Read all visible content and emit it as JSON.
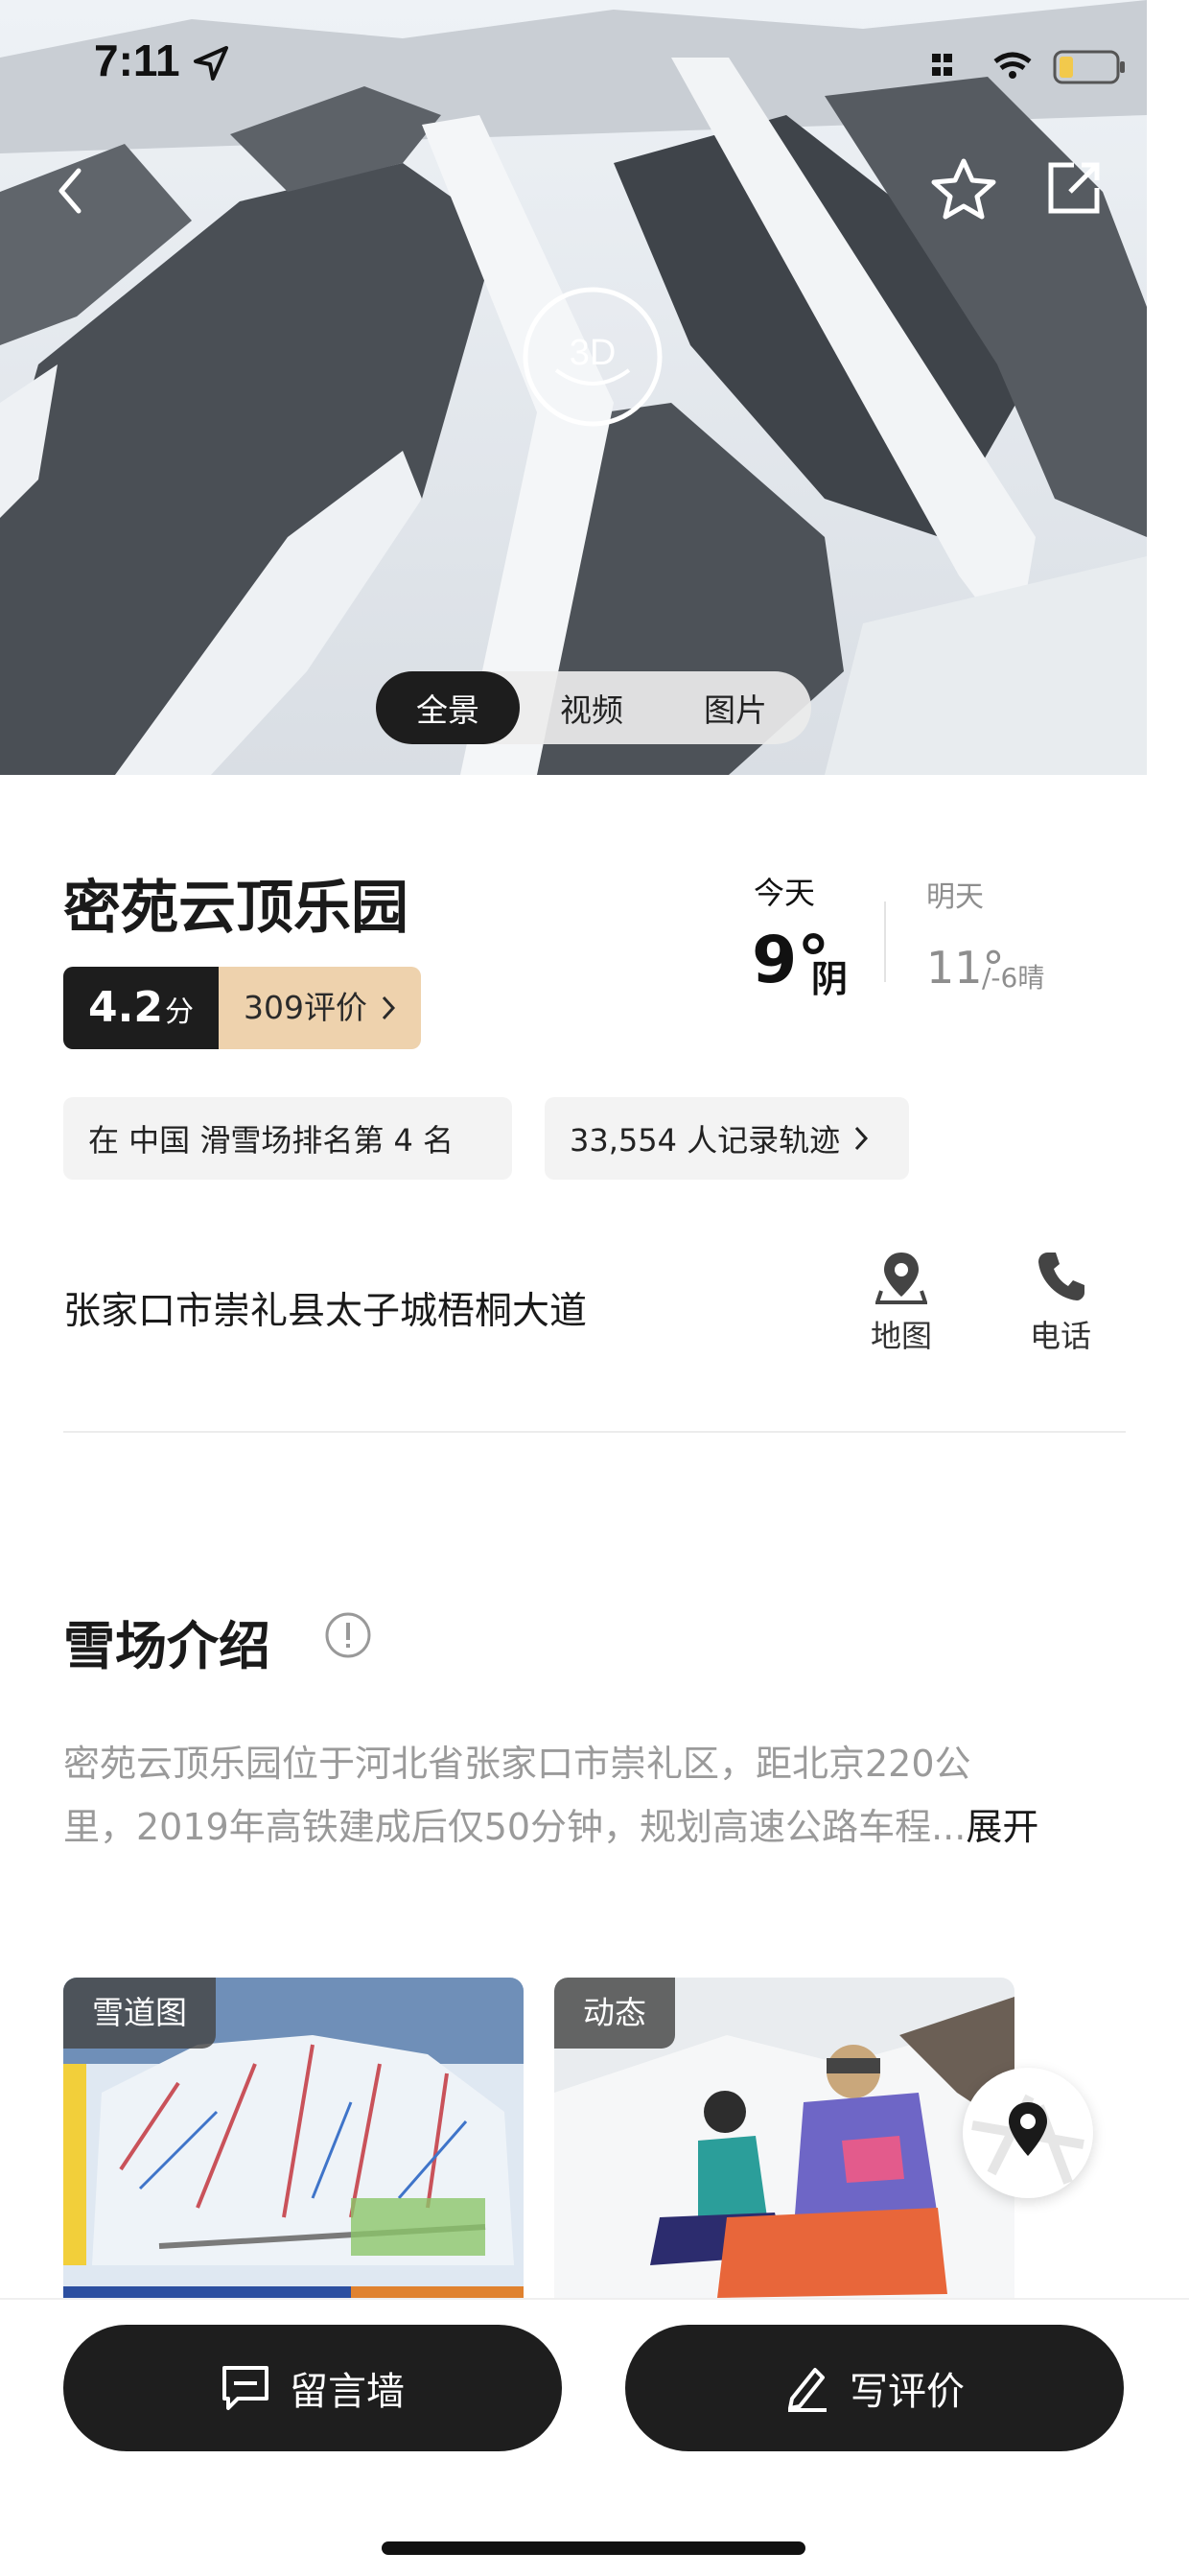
{
  "status_bar": {
    "time": "7:11"
  },
  "hero": {
    "badge_3d": "3D",
    "media_tabs": [
      {
        "label": "全景",
        "active": true
      },
      {
        "label": "视频",
        "active": false
      },
      {
        "label": "图片",
        "active": false
      }
    ]
  },
  "resort": {
    "name": "密苑云顶乐园",
    "rating_score": "4.2",
    "rating_unit": "分",
    "reviews": "309评价",
    "ranking": "在 中国 滑雪场排名第 4 名",
    "tracks": "33,554 人记录轨迹",
    "address": "张家口市崇礼县太子城梧桐大道"
  },
  "weather": {
    "today_label": "今天",
    "today_temp": "9°",
    "today_condition": "阴",
    "tomorrow_label": "明天",
    "tomorrow_temp": "11°",
    "tomorrow_low": "/-6晴"
  },
  "actions": {
    "map": "地图",
    "phone": "电话"
  },
  "intro": {
    "title": "雪场介绍",
    "line1": "密苑云顶乐园位于河北省张家口市崇礼区，距北京220公",
    "line2": "里，2019年高铁建成后仅50分钟，规划高速公路车程...",
    "expand": "展开"
  },
  "cards": [
    {
      "tag": "雪道图"
    },
    {
      "tag": "动态"
    }
  ],
  "bottom": {
    "message_wall": "留言墙",
    "write_review": "写评价"
  },
  "colors": {
    "dark": "#1d1d1d",
    "review_bg": "#eed2ad",
    "chip_bg": "#f3f3f3",
    "muted": "#9a9a9a"
  }
}
